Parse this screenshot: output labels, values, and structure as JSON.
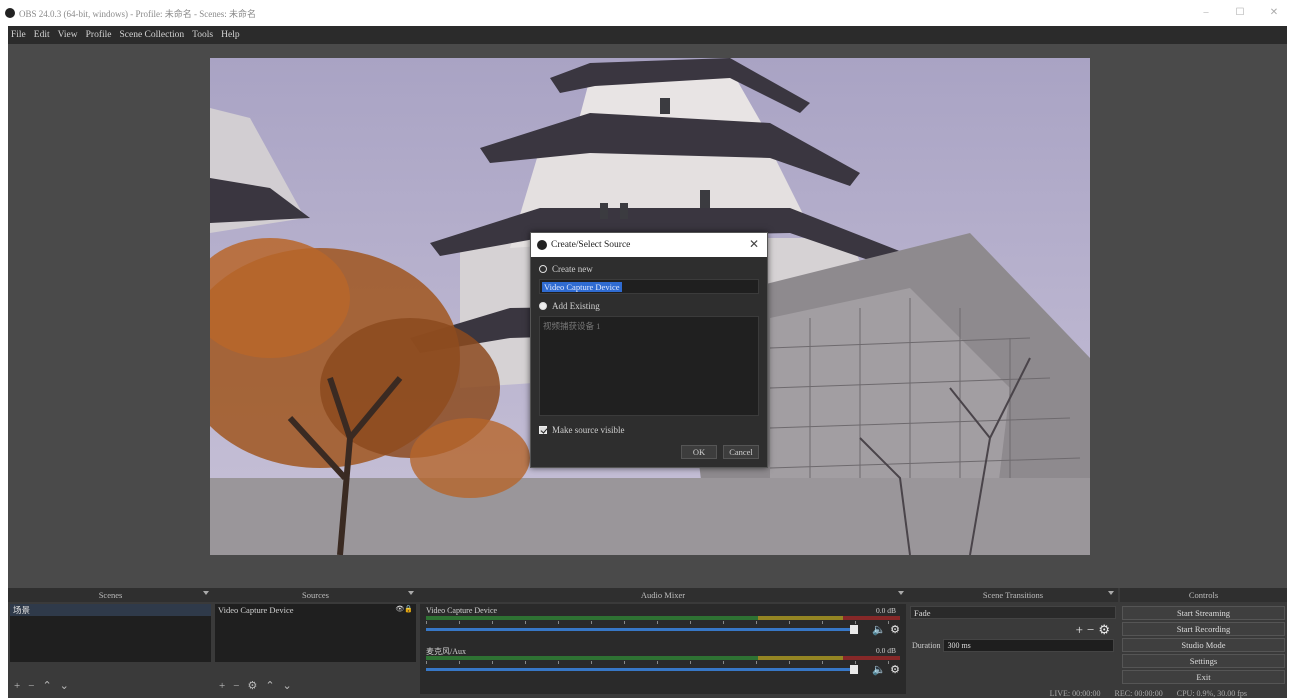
{
  "window": {
    "title": "OBS 24.0.3 (64-bit, windows) - Profile: 未命名 - Scenes: 未命名",
    "buttons": [
      "–",
      "☐",
      "✕"
    ]
  },
  "menu": [
    "File",
    "Edit",
    "View",
    "Profile",
    "Scene Collection",
    "Tools",
    "Help"
  ],
  "dialog": {
    "title": "Create/Select Source",
    "create_new_label": "Create new",
    "name_value": "Video Capture Device",
    "add_existing_label": "Add Existing",
    "existing_item": "视频捕获设备 1",
    "make_visible_label": "Make source visible",
    "ok_label": "OK",
    "cancel_label": "Cancel"
  },
  "docks": {
    "scenes": {
      "title": "Scenes",
      "items": [
        "场景"
      ]
    },
    "sources": {
      "title": "Sources",
      "items": [
        "Video Capture Device"
      ]
    },
    "mixer": {
      "title": "Audio Mixer",
      "tracks": [
        {
          "name": "Video Capture Device",
          "db": "0.0 dB"
        },
        {
          "name": "麦克风/Aux",
          "db": "0.0 dB"
        }
      ]
    },
    "transitions": {
      "title": "Scene Transitions",
      "selected": "Fade",
      "duration_label": "Duration",
      "duration_value": "300 ms"
    },
    "controls": {
      "title": "Controls",
      "buttons": [
        "Start Streaming",
        "Start Recording",
        "Studio Mode",
        "Settings",
        "Exit"
      ]
    }
  },
  "status": {
    "live": "LIVE: 00:00:00",
    "rec": "REC: 00:00:00",
    "cpu": "CPU: 0.9%, 30.00 fps"
  },
  "colors": {
    "frame": "#454545",
    "panel": "#1f1f1f",
    "selection": "#2f6bd1"
  }
}
